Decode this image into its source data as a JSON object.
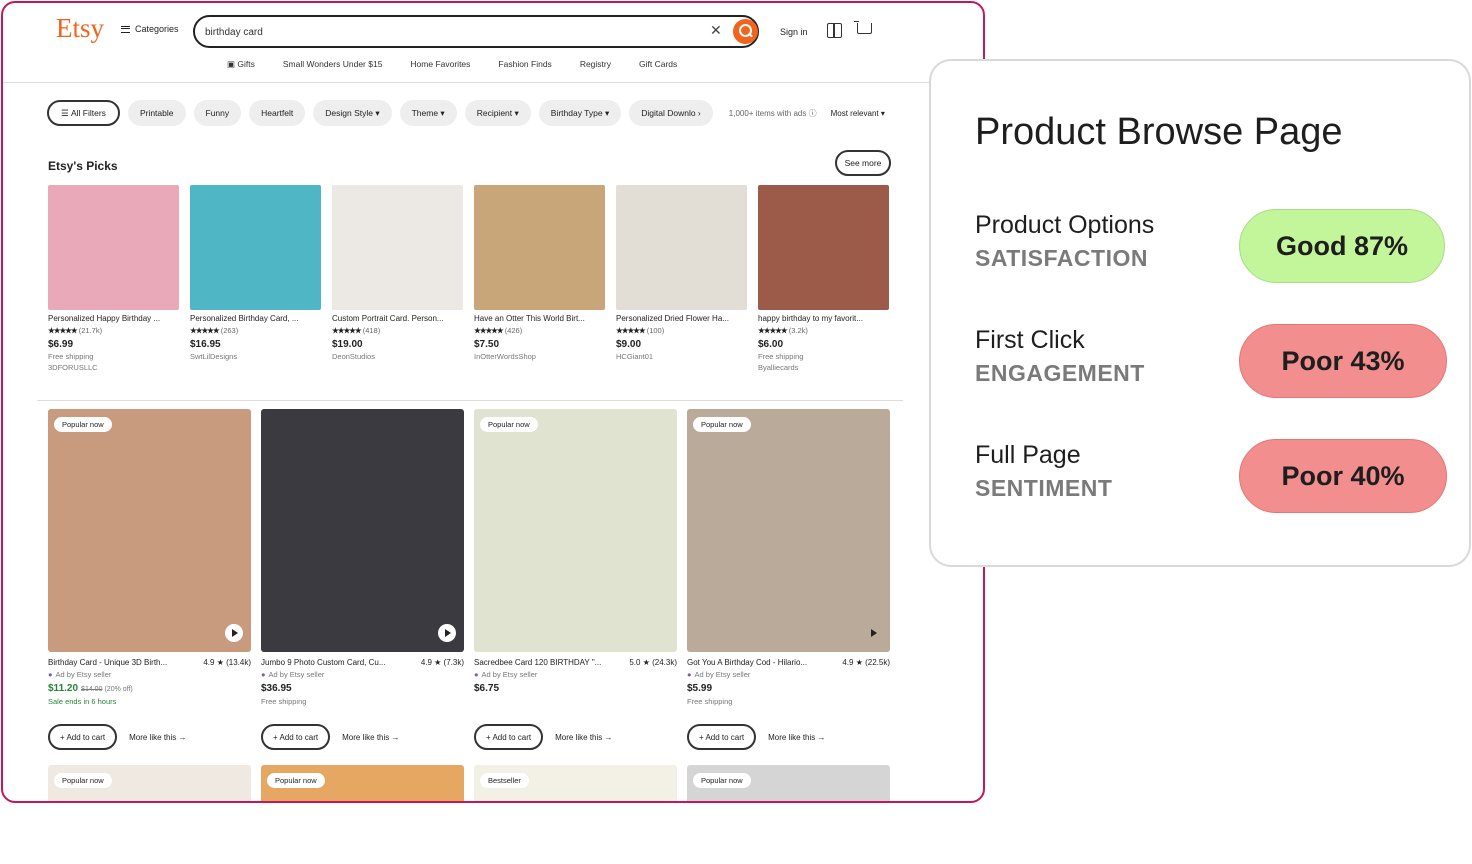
{
  "header": {
    "logo": "Etsy",
    "categories_label": "Categories",
    "search_value": "birthday card",
    "signin_label": "Sign in",
    "nav": [
      "Gifts",
      "Small Wonders Under $15",
      "Home Favorites",
      "Fashion Finds",
      "Registry",
      "Gift Cards"
    ]
  },
  "filters": {
    "all_filters": "All Filters",
    "chips": [
      "Printable",
      "Funny",
      "Heartfelt",
      "Design Style ▾",
      "Theme ▾",
      "Recipient ▾",
      "Birthday Type ▾",
      "Digital Downlo ›"
    ],
    "count": "1,000+ items with ads ⓘ",
    "sort": "Most relevant ▾"
  },
  "picks": {
    "title": "Etsy's Picks",
    "see_more": "See more",
    "items": [
      {
        "title": "Personalized Happy Birthday ...",
        "stars": "★★★★★",
        "reviews": "(21.7k)",
        "price": "$6.99",
        "shipping": "Free shipping",
        "shop": "3DFORUSLLC",
        "color": "#e9a9b9"
      },
      {
        "title": "Personalized Birthday Card, ...",
        "stars": "★★★★★",
        "reviews": "(263)",
        "price": "$16.95",
        "shipping": "",
        "shop": "SwtLilDesigns",
        "color": "#4fb6c6"
      },
      {
        "title": "Custom Portrait Card. Person...",
        "stars": "★★★★★",
        "reviews": "(418)",
        "price": "$19.00",
        "shipping": "",
        "shop": "DeonStudios",
        "color": "#ece9e5"
      },
      {
        "title": "Have an Otter This World Birt...",
        "stars": "★★★★★",
        "reviews": "(426)",
        "price": "$7.50",
        "shipping": "",
        "shop": "InOtterWordsShop",
        "color": "#c9a57a"
      },
      {
        "title": "Personalized Dried Flower Ha...",
        "stars": "★★★★★",
        "reviews": "(100)",
        "price": "$9.00",
        "shipping": "",
        "shop": "HCGiant01",
        "color": "#e3ded5"
      },
      {
        "title": "happy birthday to my favorit...",
        "stars": "★★★★★",
        "reviews": "(3.2k)",
        "price": "$6.00",
        "shipping": "Free shipping",
        "shop": "Byalliecards",
        "color": "#9c5a48"
      }
    ]
  },
  "listings": [
    {
      "badge": "Popular now",
      "title": "Birthday Card - Unique 3D Birth...",
      "rating": "4.9 ★ (13.4k)",
      "ad": "Ad by Etsy seller",
      "price": "$11.20",
      "old_price": "$14.00",
      "discount": "(20% off)",
      "note": "Sale ends in 6 hours",
      "add": "+ Add to cart",
      "more": "More like this →",
      "color": "#c89b7e"
    },
    {
      "badge": "",
      "title": "Jumbo 9 Photo Custom Card, Cu...",
      "rating": "4.9 ★ (7.3k)",
      "ad": "Ad by Etsy seller",
      "price": "$36.95",
      "old_price": "",
      "discount": "",
      "note": "Free shipping",
      "add": "+ Add to cart",
      "more": "More like this →",
      "color": "#3a3a40"
    },
    {
      "badge": "Popular now",
      "title": "Sacredbee Card 120 BIRTHDAY \"...",
      "rating": "5.0 ★ (24.3k)",
      "ad": "Ad by Etsy seller",
      "price": "$6.75",
      "old_price": "",
      "discount": "",
      "note": "",
      "add": "+ Add to cart",
      "more": "More like this →",
      "color": "#dfe3cf"
    },
    {
      "badge": "Popular now",
      "title": "Got You A Birthday Cod - Hilario...",
      "rating": "4.9 ★ (22.5k)",
      "ad": "Ad by Etsy seller",
      "price": "$5.99",
      "old_price": "",
      "discount": "",
      "note": "Free shipping",
      "add": "+ Add to cart",
      "more": "More like this →",
      "color": "#b9aa99"
    }
  ],
  "row2": [
    {
      "badge": "Popular now",
      "color": "#efe9e1"
    },
    {
      "badge": "Popular now",
      "color": "#e6a763"
    },
    {
      "badge": "Bestseller",
      "color": "#f3f0e6"
    },
    {
      "badge": "Popular now",
      "color": "#d5d5d5"
    }
  ],
  "panel": {
    "title": "Product Browse Page",
    "metrics": [
      {
        "label": "Product Options",
        "sub": "SATISFACTION",
        "value": "Good 87%",
        "status": "good",
        "percent": 87
      },
      {
        "label": "First Click",
        "sub": "ENGAGEMENT",
        "value": "Poor 43%",
        "status": "poor",
        "percent": 43
      },
      {
        "label": "Full Page",
        "sub": "SENTIMENT",
        "value": "Poor 40%",
        "status": "poor",
        "percent": 40
      }
    ]
  }
}
